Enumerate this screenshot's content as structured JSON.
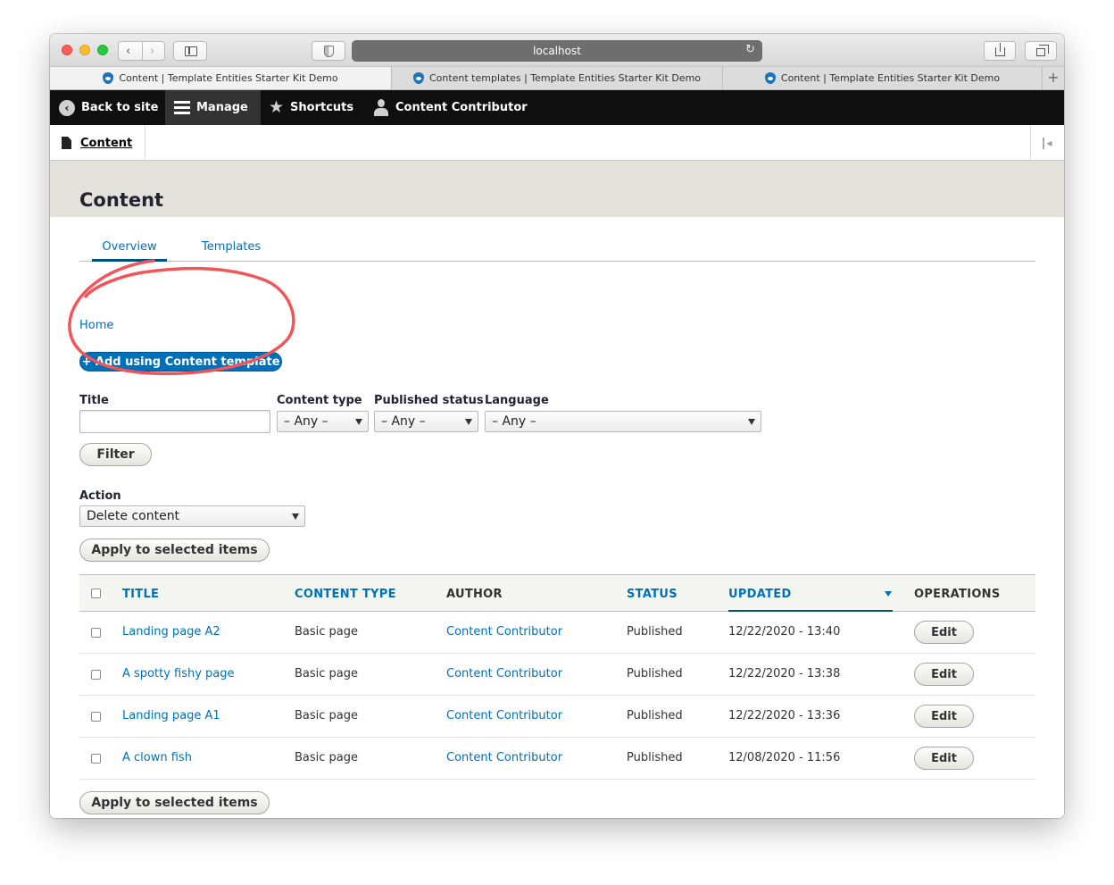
{
  "browser": {
    "url": "localhost",
    "tabs": [
      {
        "title": "Content | Template Entities Starter Kit Demo",
        "active": true
      },
      {
        "title": "Content templates | Template Entities Starter Kit Demo",
        "active": false
      },
      {
        "title": "Content | Template Entities Starter Kit Demo",
        "active": false
      }
    ],
    "new_tab_label": "+"
  },
  "toolbar": {
    "back_to_site": "Back to site",
    "manage": "Manage",
    "shortcuts": "Shortcuts",
    "user": "Content Contributor"
  },
  "tray": {
    "content_link": "Content"
  },
  "page": {
    "title": "Content",
    "tabs": [
      {
        "label": "Overview",
        "active": true
      },
      {
        "label": "Templates",
        "active": false
      }
    ],
    "breadcrumb": "Home",
    "add_button": "+ Add using Content template"
  },
  "filters": {
    "title_label": "Title",
    "title_value": "",
    "content_type_label": "Content type",
    "content_type_value": "– Any –",
    "published_status_label": "Published status",
    "published_status_value": "– Any –",
    "language_label": "Language",
    "language_value": "– Any –",
    "filter_button": "Filter"
  },
  "bulk": {
    "action_label": "Action",
    "action_value": "Delete content",
    "apply_button": "Apply to selected items",
    "apply_button_bottom": "Apply to selected items"
  },
  "table": {
    "headers": {
      "title": "TITLE",
      "content_type": "CONTENT TYPE",
      "author": "AUTHOR",
      "status": "STATUS",
      "updated": "UPDATED",
      "operations": "OPERATIONS"
    },
    "rows": [
      {
        "title": "Landing page A2",
        "type": "Basic page",
        "author": "Content Contributor",
        "status": "Published",
        "updated": "12/22/2020 - 13:40",
        "op": "Edit"
      },
      {
        "title": "A spotty fishy page",
        "type": "Basic page",
        "author": "Content Contributor",
        "status": "Published",
        "updated": "12/22/2020 - 13:38",
        "op": "Edit"
      },
      {
        "title": "Landing page A1",
        "type": "Basic page",
        "author": "Content Contributor",
        "status": "Published",
        "updated": "12/22/2020 - 13:36",
        "op": "Edit"
      },
      {
        "title": "A clown fish",
        "type": "Basic page",
        "author": "Content Contributor",
        "status": "Published",
        "updated": "12/08/2020 - 11:56",
        "op": "Edit"
      }
    ]
  },
  "colors": {
    "link": "#0071b8",
    "primary_button": "#0071b8",
    "toolbar_bg": "#0f0f0f",
    "header_bg": "#e3e3db",
    "annotation": "#f0555a"
  }
}
